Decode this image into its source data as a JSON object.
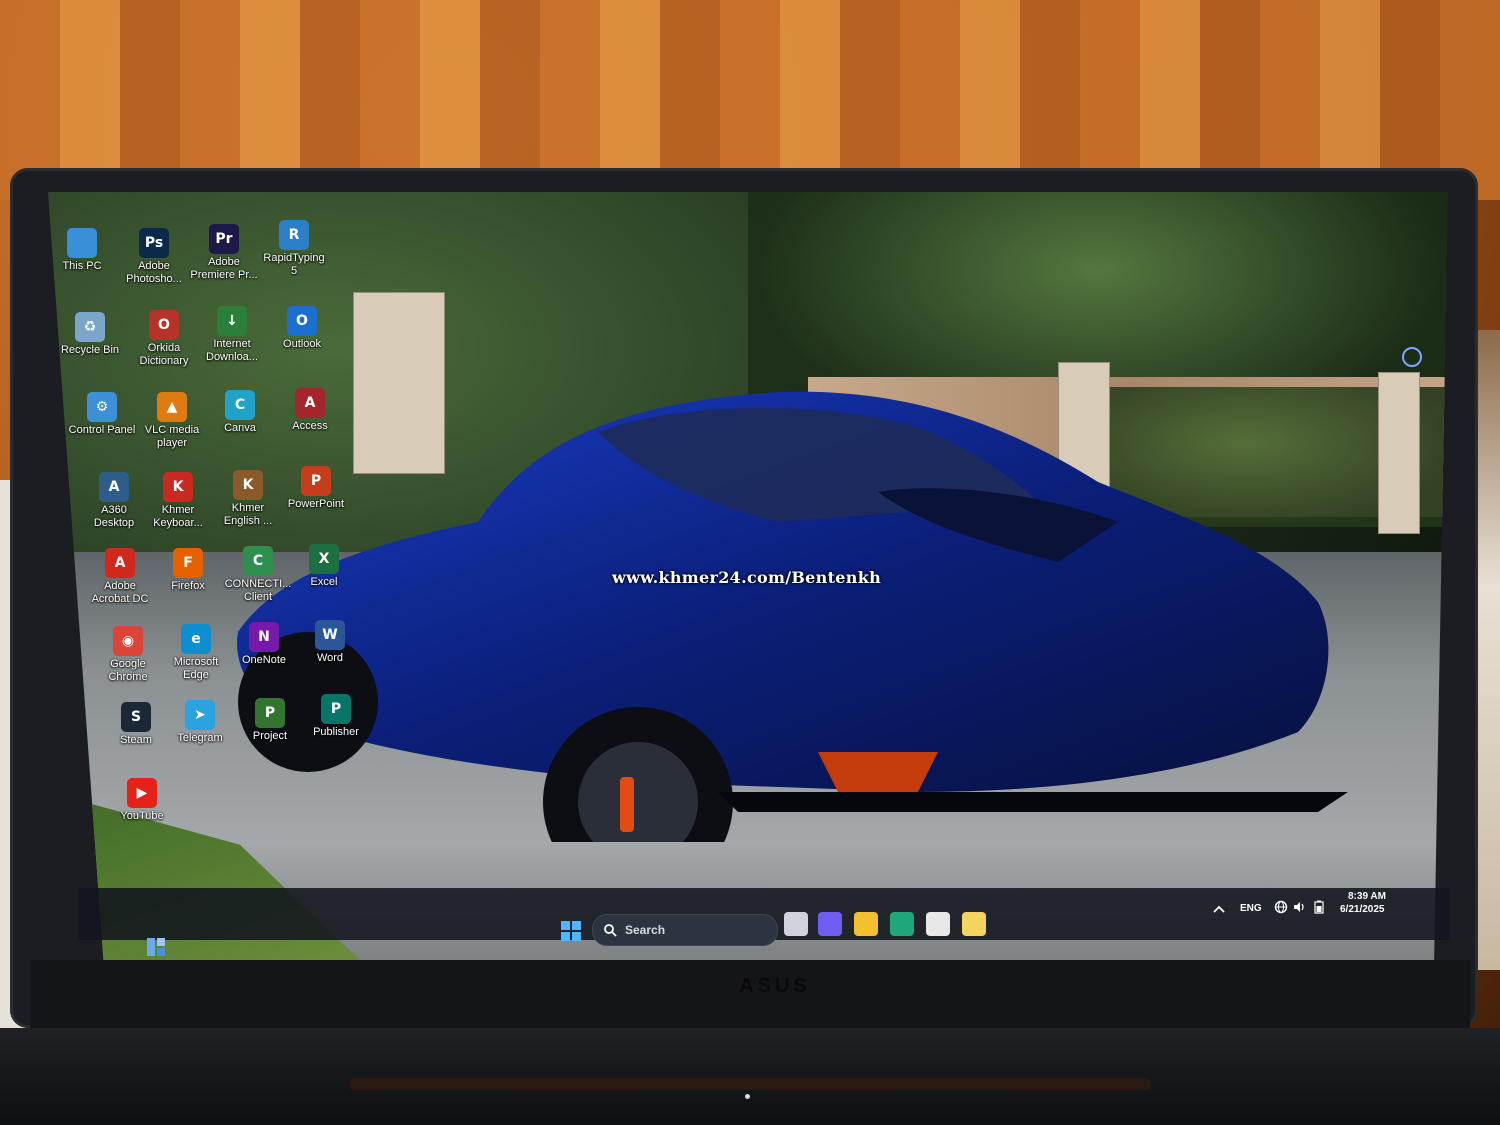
{
  "watermark": "www.khmer24.com/Bentenkh",
  "desktop_icons": [
    {
      "label": "This PC",
      "icon": "monitor-icon",
      "color": "#3a8fd9",
      "glyph": ""
    },
    {
      "label": "Adobe\nPhotosho...",
      "icon": "photoshop-icon",
      "color": "#0b2a4a",
      "glyph": "Ps"
    },
    {
      "label": "Adobe\nPremiere Pr...",
      "icon": "premiere-icon",
      "color": "#1d1a4a",
      "glyph": "Pr"
    },
    {
      "label": "RapidTyping\n5",
      "icon": "rapidtyping-icon",
      "color": "#2b7fc7",
      "glyph": "R"
    },
    {
      "label": "Recycle Bin",
      "icon": "recycle-bin-icon",
      "color": "#7aa6c9",
      "glyph": "♻"
    },
    {
      "label": "Orkida\nDictionary",
      "icon": "dictionary-icon",
      "color": "#b7332a",
      "glyph": "O"
    },
    {
      "label": "Internet\nDownloa...",
      "icon": "idm-icon",
      "color": "#2c7f3a",
      "glyph": "↓"
    },
    {
      "label": "Outlook",
      "icon": "outlook-icon",
      "color": "#1b6fd0",
      "glyph": "O"
    },
    {
      "label": "Control Panel",
      "icon": "control-panel-icon",
      "color": "#3d8fd6",
      "glyph": "⚙"
    },
    {
      "label": "VLC media\nplayer",
      "icon": "vlc-icon",
      "color": "#e07b12",
      "glyph": "▲"
    },
    {
      "label": "Canva",
      "icon": "canva-icon",
      "color": "#1fa3c9",
      "glyph": "C"
    },
    {
      "label": "Access",
      "icon": "access-icon",
      "color": "#a4262c",
      "glyph": "A"
    },
    {
      "label": "A360\nDesktop",
      "icon": "a360-icon",
      "color": "#2e5d8a",
      "glyph": "A"
    },
    {
      "label": "Khmer\nKeyboar...",
      "icon": "pdf-icon",
      "color": "#c9291f",
      "glyph": "K"
    },
    {
      "label": "Khmer\nEnglish ...",
      "icon": "dictionary-book-icon",
      "color": "#8a5a2b",
      "glyph": "K"
    },
    {
      "label": "PowerPoint",
      "icon": "powerpoint-icon",
      "color": "#c43e1c",
      "glyph": "P"
    },
    {
      "label": "Adobe\nAcrobat DC",
      "icon": "acrobat-icon",
      "color": "#d0281b",
      "glyph": "A"
    },
    {
      "label": "Firefox",
      "icon": "firefox-icon",
      "color": "#e66000",
      "glyph": "F"
    },
    {
      "label": "CONNECTI...\nClient",
      "icon": "connecti-icon",
      "color": "#2f8f4f",
      "glyph": "C"
    },
    {
      "label": "Excel",
      "icon": "excel-icon",
      "color": "#1d6f42",
      "glyph": "X"
    },
    {
      "label": "Google\nChrome",
      "icon": "chrome-icon",
      "color": "#db4437",
      "glyph": "◉"
    },
    {
      "label": "Microsoft\nEdge",
      "icon": "edge-icon",
      "color": "#0c8ecf",
      "glyph": "e"
    },
    {
      "label": "OneNote",
      "icon": "onenote-icon",
      "color": "#7719aa",
      "glyph": "N"
    },
    {
      "label": "Word",
      "icon": "word-icon",
      "color": "#2b579a",
      "glyph": "W"
    },
    {
      "label": "Steam",
      "icon": "steam-icon",
      "color": "#1b2838",
      "glyph": "S"
    },
    {
      "label": "Telegram",
      "icon": "telegram-icon",
      "color": "#2aa3de",
      "glyph": "➤"
    },
    {
      "label": "Project",
      "icon": "project-icon",
      "color": "#31752f",
      "glyph": "P"
    },
    {
      "label": "Publisher",
      "icon": "publisher-icon",
      "color": "#077568",
      "glyph": "P"
    },
    {
      "label": "YouTube",
      "icon": "youtube-icon",
      "color": "#e62117",
      "glyph": "▶"
    }
  ],
  "taskbar": {
    "search_placeholder": "Search",
    "apps": [
      {
        "icon": "task-view-icon",
        "color": "#d0d4da"
      },
      {
        "icon": "copilot-icon",
        "color": "#6f5cf0"
      },
      {
        "icon": "file-explorer-icon",
        "color": "#f3c12d"
      },
      {
        "icon": "edge-icon",
        "color": "#1fa67a"
      },
      {
        "icon": "microsoft-store-icon",
        "color": "#e8e8e8"
      },
      {
        "icon": "notepad-icon",
        "color": "#f4d35e"
      }
    ],
    "language": "ENG",
    "time": "8:39 AM",
    "date": "6/21/2025"
  }
}
